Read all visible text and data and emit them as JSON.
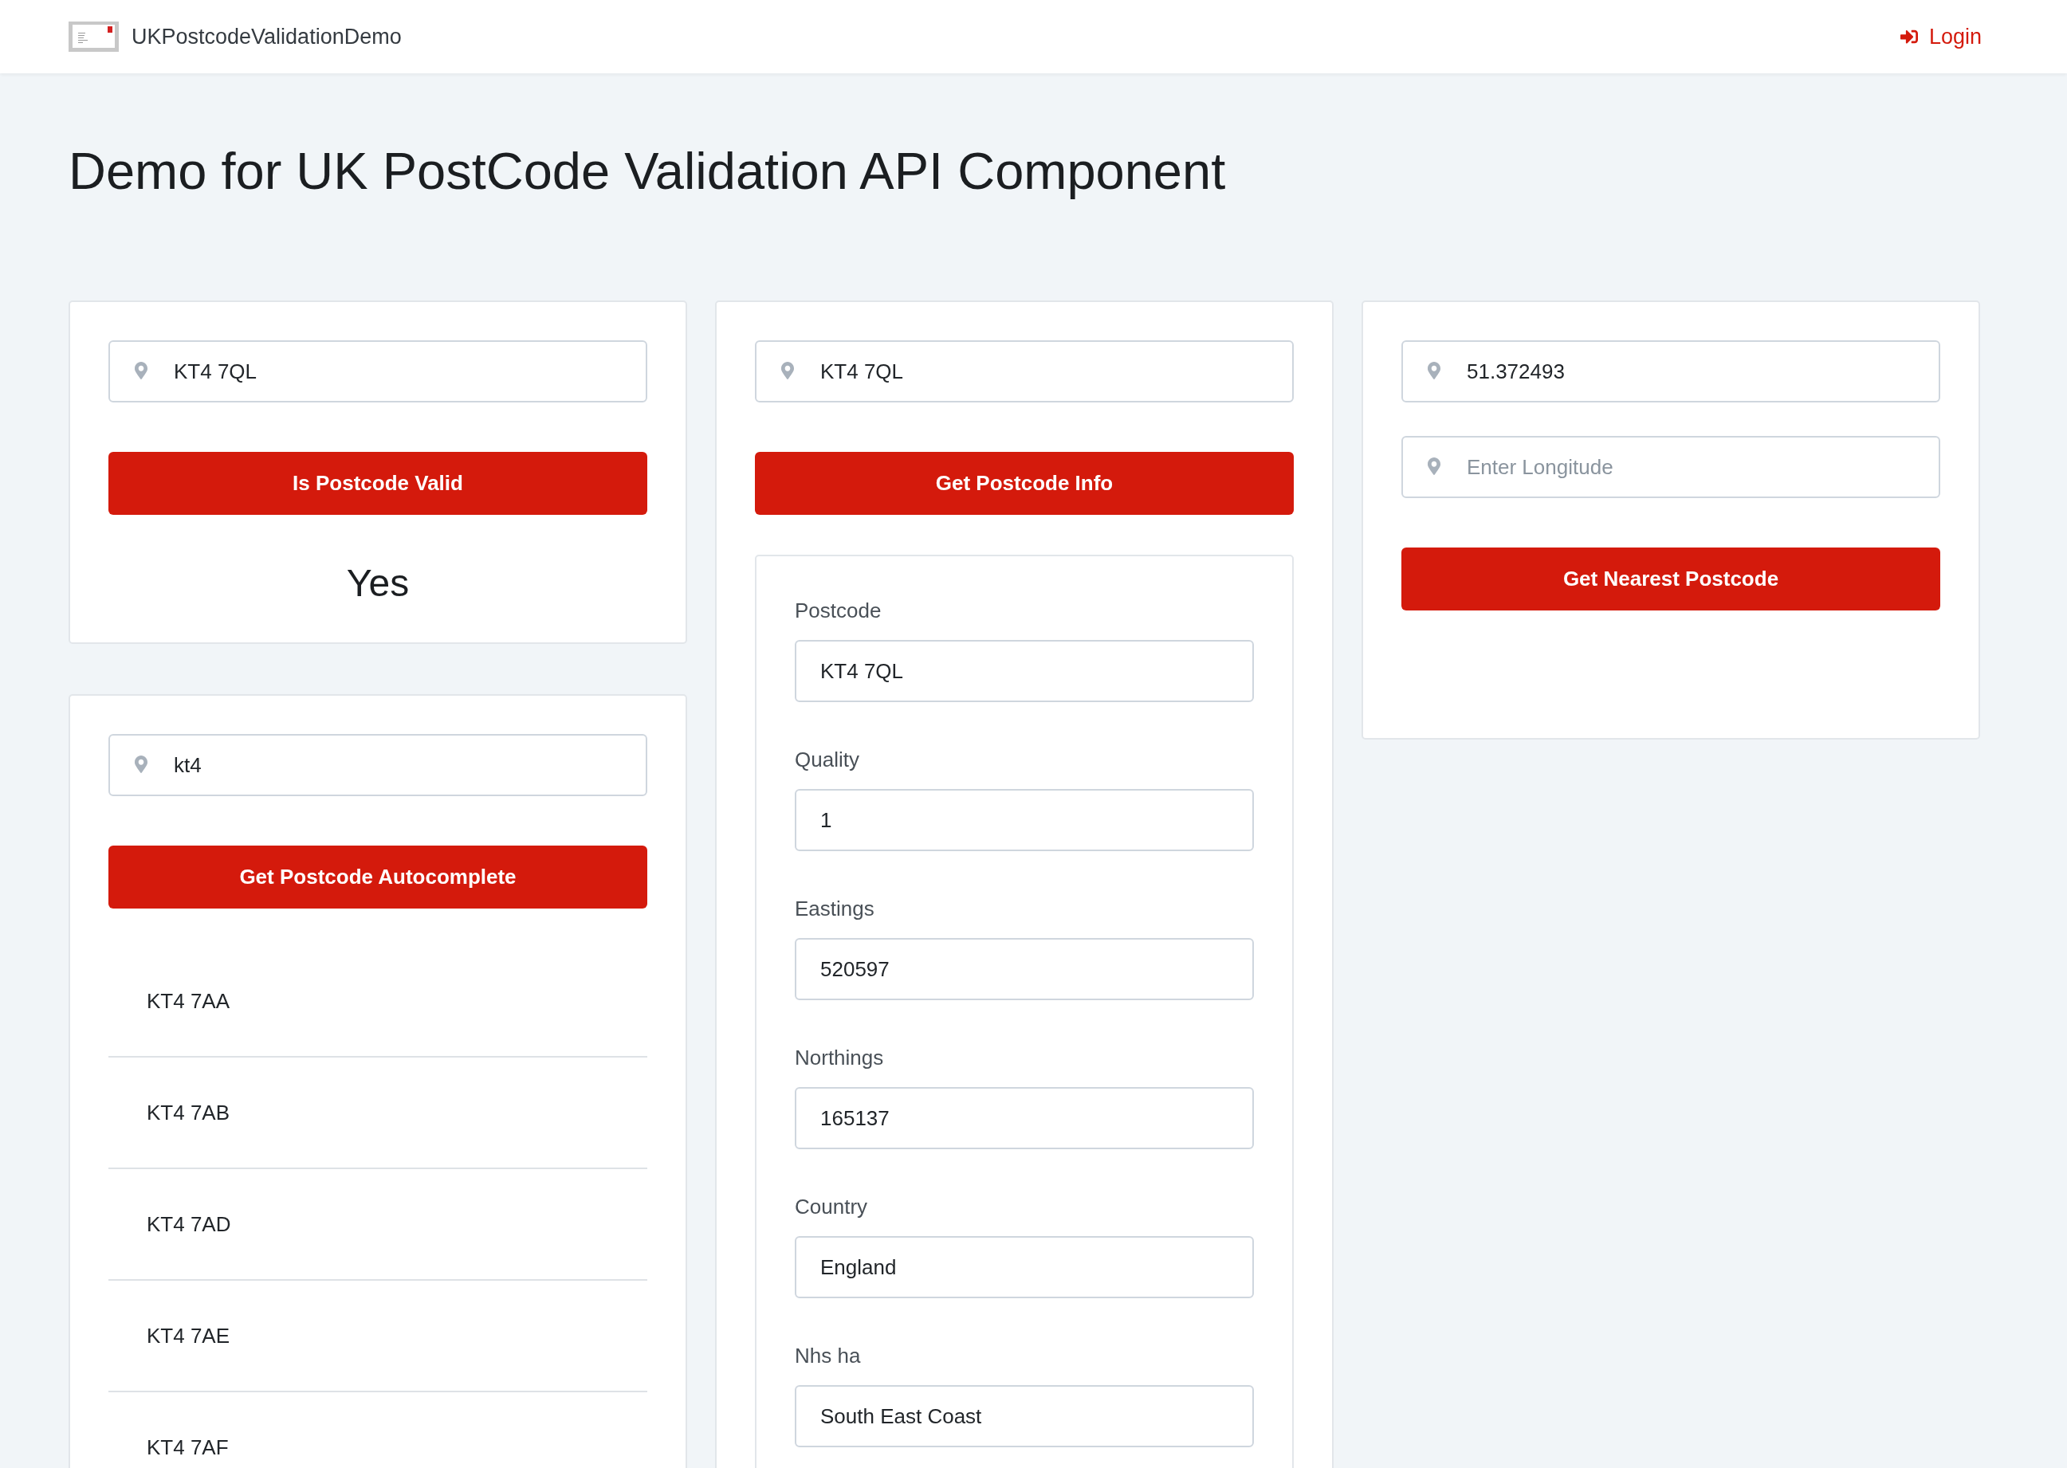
{
  "navbar": {
    "brand": "UKPostcodeValidationDemo",
    "login_link": "Login"
  },
  "title": "Demo for UK PostCode Validation API Component",
  "columns": [
    {
      "cards": [
        {
          "kind": "check",
          "fields": [
            {
              "value": "KT4 7QL"
            }
          ],
          "button": "Is Postcode Valid",
          "result": "Yes"
        },
        {
          "kind": "autocomplete",
          "fields": [
            {
              "value": "kt4"
            }
          ],
          "button": "Get Postcode Autocomplete",
          "suggestions": [
            "KT4 7AA",
            "KT4 7AB",
            "KT4 7AD",
            "KT4 7AE",
            "KT4 7AF"
          ]
        }
      ]
    },
    {
      "cards": [
        {
          "kind": "info",
          "fields": [
            {
              "value": "KT4 7QL"
            }
          ],
          "button": "Get Postcode Info",
          "info": [
            {
              "label": "Postcode",
              "value": "KT4 7QL"
            },
            {
              "label": "Quality",
              "value": "1"
            },
            {
              "label": "Eastings",
              "value": "520597"
            },
            {
              "label": "Northings",
              "value": "165137"
            },
            {
              "label": "Country",
              "value": "England"
            },
            {
              "label": "Nhs ha",
              "value": "South East Coast"
            }
          ]
        }
      ]
    },
    {
      "cards": [
        {
          "kind": "nearest",
          "fields": [
            {
              "value": "51.372493"
            },
            {
              "placeholder": "Enter Longitude"
            }
          ],
          "button": "Get Nearest Postcode"
        }
      ]
    }
  ]
}
